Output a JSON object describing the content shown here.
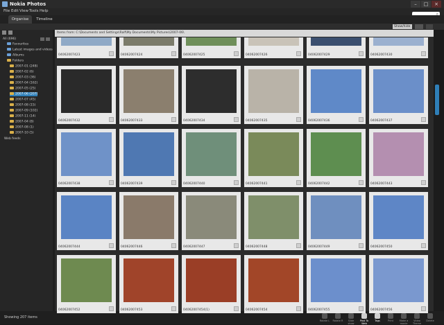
{
  "window": {
    "title": "Nokia Photos"
  },
  "menu": [
    "File",
    "Edit",
    "View",
    "Tools",
    "Help"
  ],
  "tabs": [
    "Organise",
    "Timeline"
  ],
  "view_select": "Show/hide ▾",
  "path_label": "Items from: C:\\Documents and Settings\\Ralf\\My Documents\\My Pictures\\2007-06\\",
  "sidebar": {
    "root": "All (696)",
    "items": [
      {
        "label": "Favourites"
      },
      {
        "label": "Latest images and videos (5)"
      },
      {
        "label": "Albums"
      },
      {
        "label": "Folders"
      }
    ],
    "folders": [
      "2007-01 (248)",
      "2007-02 (6)",
      "2007-03 (36)",
      "2007-04 (162)",
      "2007-05 (25)",
      "2007-06 (207)",
      "2007-07 (45)",
      "2007-08 (15)",
      "2007-09 (102)",
      "2007-11 (14)",
      "2007-04 (8)",
      "2007-08 (1)",
      "2007-10 (5)"
    ],
    "web": "Web feeds"
  },
  "rows": [
    [
      "04062007423",
      "04062007424",
      "04062007425",
      "04062007426",
      "04062007429",
      "04062007430"
    ],
    [
      "04062007432",
      "04062007433",
      "04062007434",
      "04062007435",
      "04062007436",
      "04062007437"
    ],
    [
      "04062007438",
      "04062007439",
      "04062007440",
      "04062007441",
      "04062007442",
      "04062007443"
    ],
    [
      "04062007444",
      "04062007446",
      "04062007447",
      "04062007448",
      "04062007449",
      "04062007450"
    ],
    [
      "04062007452",
      "04062007453",
      "04062007454(1)",
      "04062007454",
      "04062007455",
      "04062007456"
    ]
  ],
  "status": "Showing 207 items",
  "actions": [
    "Rotate L",
    "Rotate R",
    "Slide show",
    "Post To Web",
    "Tags",
    "Print",
    "Make a movie",
    "Video Theme",
    "Delete"
  ]
}
